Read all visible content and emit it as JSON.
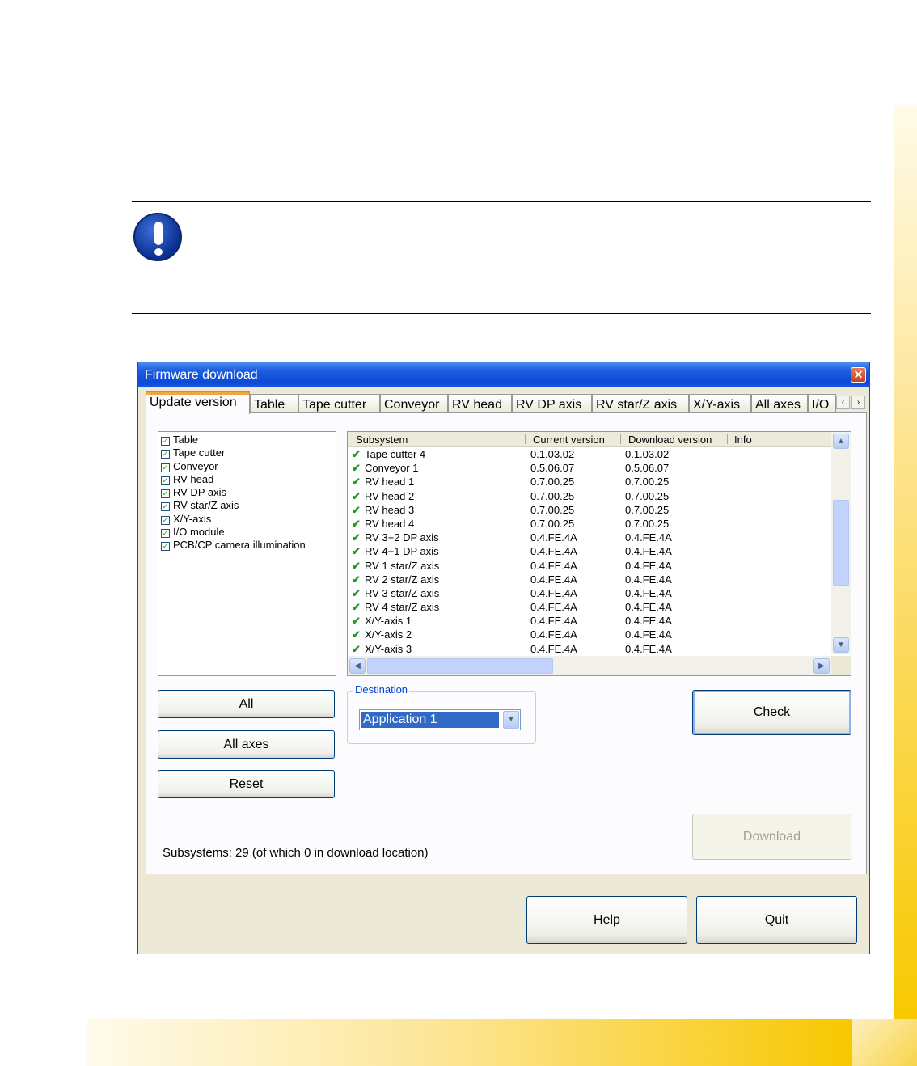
{
  "window": {
    "title": "Firmware download",
    "close_glyph": "✕"
  },
  "tabs": [
    "Update version",
    "Table",
    "Tape cutter",
    "Conveyor",
    "RV head",
    "RV DP axis",
    "RV star/Z axis",
    "X/Y-axis",
    "All axes",
    "I/O"
  ],
  "tab_scroll": {
    "left": "‹",
    "right": "›"
  },
  "subsystem_checklist": [
    "Table",
    "Tape cutter",
    "Conveyor",
    "RV head",
    "RV DP axis",
    "RV star/Z axis",
    "X/Y-axis",
    "I/O module",
    "PCB/CP camera illumination"
  ],
  "check_glyph": "✓",
  "list": {
    "columns": [
      "Subsystem",
      "Current version",
      "Download version",
      "Info"
    ],
    "status_glyph": "✔",
    "rows": [
      [
        "Tape cutter 4",
        "0.1.03.02",
        "0.1.03.02"
      ],
      [
        "Conveyor 1",
        "0.5.06.07",
        "0.5.06.07"
      ],
      [
        "RV head 1",
        "0.7.00.25",
        "0.7.00.25"
      ],
      [
        "RV head 2",
        "0.7.00.25",
        "0.7.00.25"
      ],
      [
        "RV head 3",
        "0.7.00.25",
        "0.7.00.25"
      ],
      [
        "RV head 4",
        "0.7.00.25",
        "0.7.00.25"
      ],
      [
        "RV 3+2 DP axis",
        "0.4.FE.4A",
        "0.4.FE.4A"
      ],
      [
        "RV 4+1 DP axis",
        "0.4.FE.4A",
        "0.4.FE.4A"
      ],
      [
        "RV 1 star/Z axis",
        "0.4.FE.4A",
        "0.4.FE.4A"
      ],
      [
        "RV 2 star/Z axis",
        "0.4.FE.4A",
        "0.4.FE.4A"
      ],
      [
        "RV 3 star/Z axis",
        "0.4.FE.4A",
        "0.4.FE.4A"
      ],
      [
        "RV 4 star/Z axis",
        "0.4.FE.4A",
        "0.4.FE.4A"
      ],
      [
        "X/Y-axis 1",
        "0.4.FE.4A",
        "0.4.FE.4A"
      ],
      [
        "X/Y-axis 2",
        "0.4.FE.4A",
        "0.4.FE.4A"
      ],
      [
        "X/Y-axis 3",
        "0.4.FE.4A",
        "0.4.FE.4A"
      ]
    ],
    "scroll_glyphs": {
      "up": "▲",
      "down": "▼",
      "left": "◀",
      "right": "▶"
    }
  },
  "buttons": {
    "all": "All",
    "all_axes": "All axes",
    "reset": "Reset",
    "check": "Check",
    "download": "Download",
    "help": "Help",
    "quit": "Quit"
  },
  "destination": {
    "label": "Destination",
    "value": "Application 1",
    "arrow": "▼"
  },
  "status_text": "Subsystems: 29 (of which 0 in download location)",
  "colors": {
    "titlebar": "#0a4ad6",
    "selection": "#316ac5",
    "accent_tab": "#f3a63f",
    "note_icon": "#0b2e8f",
    "ok_check": "#1f9a1f"
  }
}
